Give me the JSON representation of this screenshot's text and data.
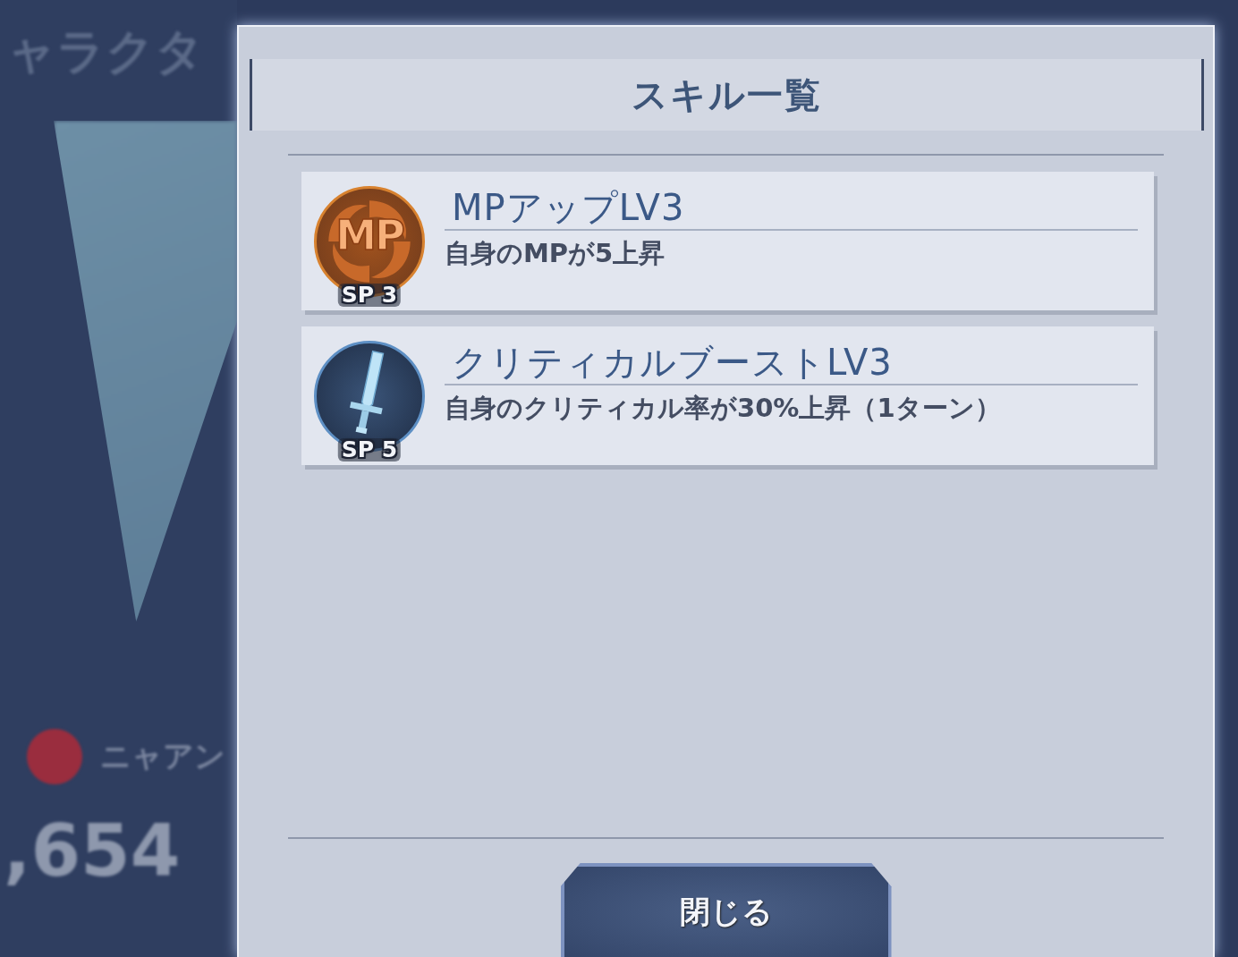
{
  "background": {
    "title": "ャラクタ",
    "name": "ニャアン",
    "value": ",654"
  },
  "dialog": {
    "title": "スキル一覧",
    "skills": [
      {
        "name": "MPアップLV3",
        "description": "自身のMPが5上昇",
        "icon": {
          "kind": "mp",
          "label": "MP"
        },
        "cost": "SP 3"
      },
      {
        "name": "クリティカルブーストLV3",
        "description": "自身のクリティカル率が30%上昇（1ターン）",
        "icon": {
          "kind": "sword"
        },
        "cost": "SP 5"
      }
    ],
    "close_button": "閉じる"
  }
}
